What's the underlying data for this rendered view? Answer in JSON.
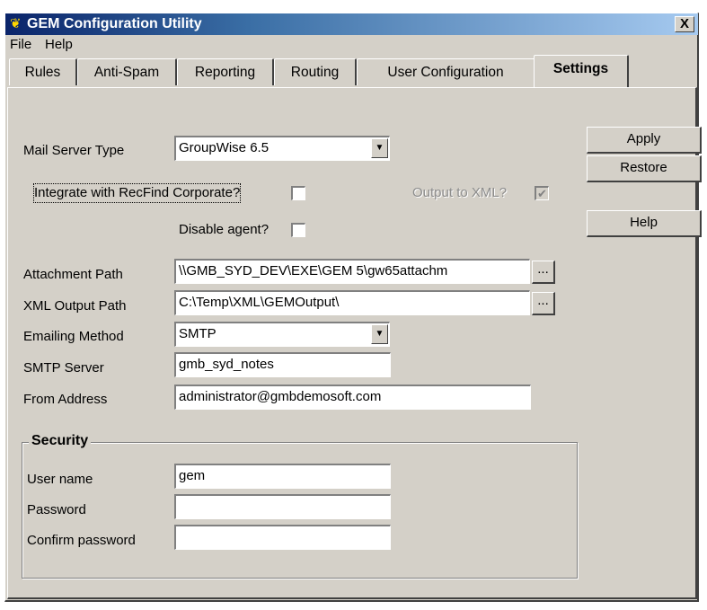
{
  "window": {
    "title": "GEM Configuration Utility",
    "close_glyph": "X"
  },
  "menu": [
    "File",
    "Help"
  ],
  "tabs": [
    "Rules",
    "Anti-Spam",
    "Reporting",
    "Routing",
    "User Configuration",
    "Settings"
  ],
  "active_tab": "Settings",
  "buttons": {
    "apply": "Apply",
    "restore": "Restore",
    "help": "Help",
    "browse": "..."
  },
  "settings": {
    "mail_server_type": {
      "label": "Mail Server Type",
      "value": "GroupWise 6.5"
    },
    "integrate_recfind": {
      "label": "Integrate with RecFind Corporate?",
      "checked": false
    },
    "output_to_xml": {
      "label": "Output to XML?",
      "checked": true,
      "enabled": false
    },
    "disable_agent": {
      "label": "Disable agent?",
      "checked": false
    },
    "attachment_path": {
      "label": "Attachment Path",
      "value": "\\\\GMB_SYD_DEV\\EXE\\GEM 5\\gw65attachm"
    },
    "xml_output_path": {
      "label": "XML Output Path",
      "value": "C:\\Temp\\XML\\GEMOutput\\"
    },
    "emailing_method": {
      "label": "Emailing Method",
      "value": "SMTP"
    },
    "smtp_server": {
      "label": "SMTP Server",
      "value": "gmb_syd_notes"
    },
    "from_address": {
      "label": "From Address",
      "value": "administrator@gmbdemosoft.com"
    }
  },
  "security": {
    "title": "Security",
    "user_name": {
      "label": "User name",
      "value": "gem"
    },
    "password": {
      "label": "Password",
      "value": ""
    },
    "confirm_password": {
      "label": "Confirm password",
      "value": ""
    }
  },
  "icons": {
    "app": "gem-logo-icon",
    "dropdown": "chevron-down-icon",
    "check": "checkmark-icon"
  },
  "colors": {
    "titlebar_start": "#0a246a",
    "titlebar_end": "#a6caf0",
    "face": "#d4d0c8"
  }
}
